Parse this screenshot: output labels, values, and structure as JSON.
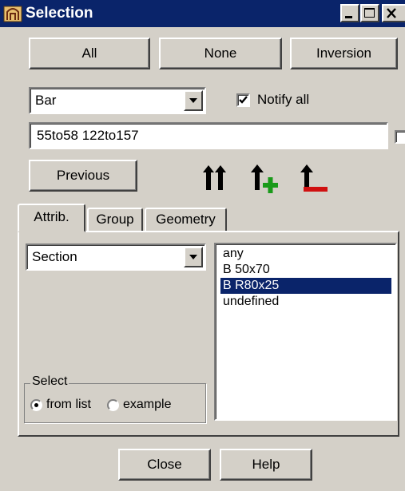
{
  "window": {
    "title": "Selection",
    "controls": [
      "minimize-icon",
      "maximize-icon",
      "close-icon"
    ]
  },
  "top_buttons": {
    "all": "All",
    "none": "None",
    "inversion": "Inversion"
  },
  "object_type": {
    "selected": "Bar"
  },
  "notify_all": {
    "label": "Notify all",
    "checked": true
  },
  "selection_field": {
    "value": "55to58 122to157"
  },
  "previous_button": "Previous",
  "toolbar_icons": [
    "move-up-all-icon",
    "add-up-icon",
    "remove-up-icon"
  ],
  "tabs": [
    {
      "label": "Attrib.",
      "active": true
    },
    {
      "label": "Group",
      "active": false
    },
    {
      "label": "Geometry",
      "active": false
    }
  ],
  "attribute_combo": {
    "selected": "Section"
  },
  "attribute_values": {
    "items": [
      "any",
      "B 50x70",
      "B R80x25",
      "undefined"
    ],
    "selected_index": 2
  },
  "select_group": {
    "legend": "Select",
    "options": [
      "from list",
      "example"
    ],
    "selected": "from list"
  },
  "bottom_buttons": {
    "close": "Close",
    "help": "Help"
  },
  "colors": {
    "titlebar": "#0a246a",
    "face": "#d4d0c8",
    "selection": "#0a246a",
    "plus": "#1a9a1a",
    "minus": "#d01010"
  }
}
